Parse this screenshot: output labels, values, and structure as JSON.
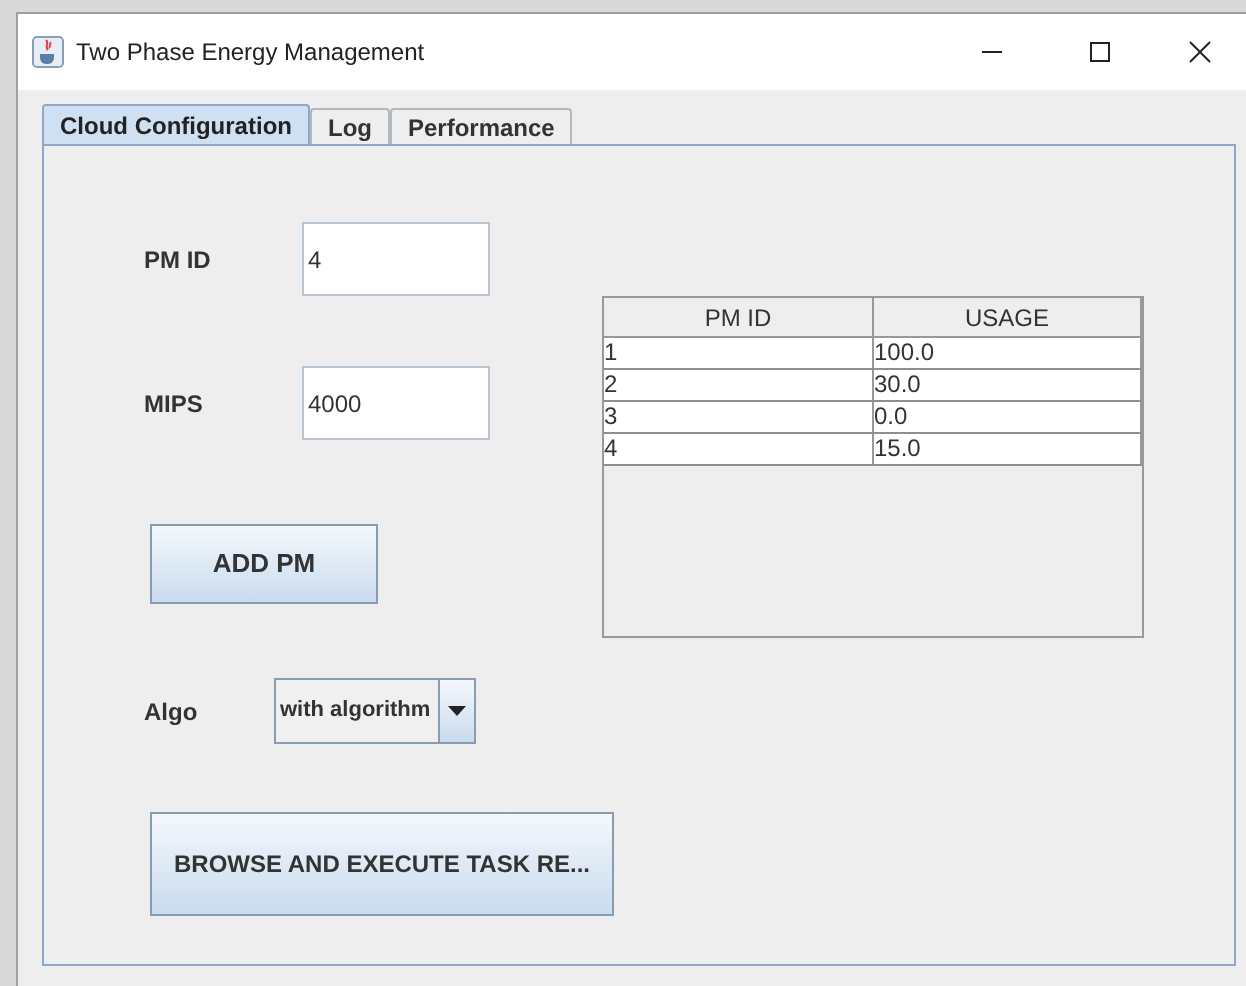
{
  "window": {
    "title": "Two Phase Energy Management"
  },
  "tabs": [
    {
      "label": "Cloud Configuration",
      "selected": true
    },
    {
      "label": "Log",
      "selected": false
    },
    {
      "label": "Performance",
      "selected": false
    }
  ],
  "form": {
    "pm_id": {
      "label": "PM ID",
      "value": "4"
    },
    "mips": {
      "label": "MIPS",
      "value": "4000"
    },
    "add_button": "ADD PM",
    "algo": {
      "label": "Algo",
      "value": "with algorithm"
    },
    "execute_button": "BROWSE AND EXECUTE TASK RE..."
  },
  "table": {
    "columns": [
      "PM ID",
      "USAGE"
    ],
    "rows": [
      [
        "1",
        "100.0"
      ],
      [
        "2",
        "30.0"
      ],
      [
        "3",
        "0.0"
      ],
      [
        "4",
        "15.0"
      ]
    ]
  }
}
